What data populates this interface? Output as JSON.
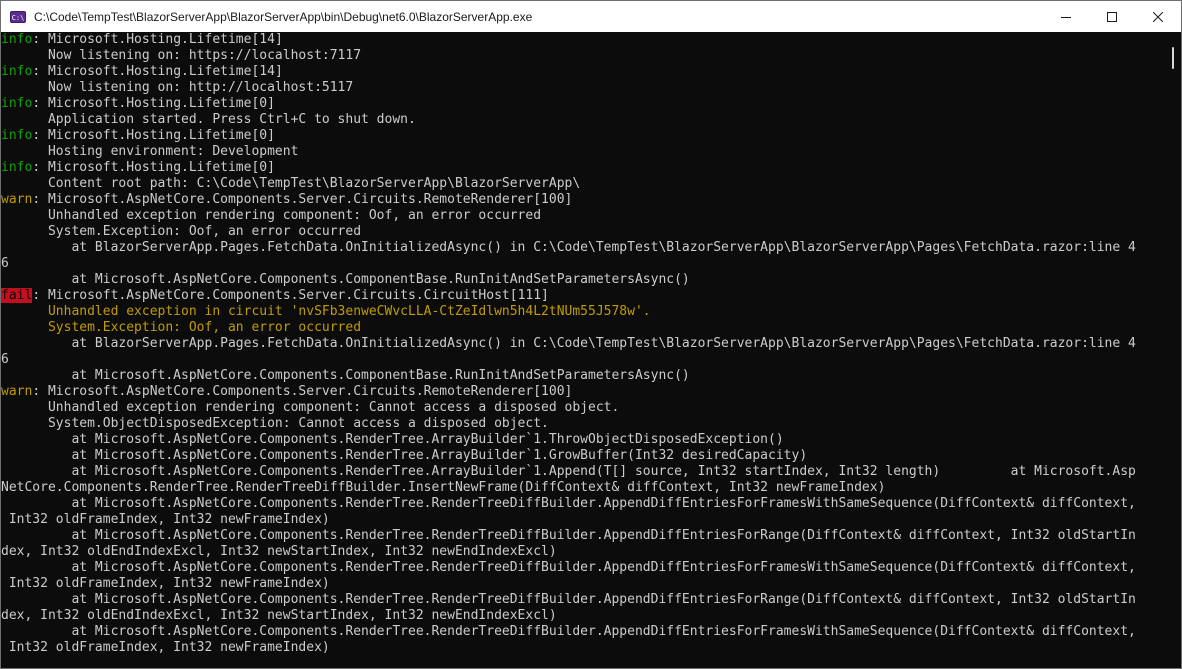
{
  "window": {
    "title": "C:\\Code\\TempTest\\BlazorServerApp\\BlazorServerApp\\bin\\Debug\\net6.0\\BlazorServerApp.exe",
    "icon_text": "C:\\",
    "icon": "console-app-icon"
  },
  "controls": {
    "minimize": "minimize-icon",
    "maximize": "maximize-icon",
    "close": "close-icon"
  },
  "colors": {
    "info": "#13a10e",
    "warn": "#c19c00",
    "fail_bg": "#c50f1f",
    "text": "#cccccc",
    "background": "#0c0c0c"
  },
  "console": {
    "lines": [
      {
        "tag": "info",
        "text": ": Microsoft.Hosting.Lifetime[14]"
      },
      {
        "tag": "",
        "text": "      Now listening on: https://localhost:7117"
      },
      {
        "tag": "info",
        "text": ": Microsoft.Hosting.Lifetime[14]"
      },
      {
        "tag": "",
        "text": "      Now listening on: http://localhost:5117"
      },
      {
        "tag": "info",
        "text": ": Microsoft.Hosting.Lifetime[0]"
      },
      {
        "tag": "",
        "text": "      Application started. Press Ctrl+C to shut down."
      },
      {
        "tag": "info",
        "text": ": Microsoft.Hosting.Lifetime[0]"
      },
      {
        "tag": "",
        "text": "      Hosting environment: Development"
      },
      {
        "tag": "info",
        "text": ": Microsoft.Hosting.Lifetime[0]"
      },
      {
        "tag": "",
        "text": "      Content root path: C:\\Code\\TempTest\\BlazorServerApp\\BlazorServerApp\\"
      },
      {
        "tag": "warn",
        "text": ": Microsoft.AspNetCore.Components.Server.Circuits.RemoteRenderer[100]"
      },
      {
        "tag": "",
        "text": "      Unhandled exception rendering component: Oof, an error occurred"
      },
      {
        "tag": "",
        "text": "      System.Exception: Oof, an error occurred"
      },
      {
        "tag": "",
        "text": "         at BlazorServerApp.Pages.FetchData.OnInitializedAsync() in C:\\Code\\TempTest\\BlazorServerApp\\BlazorServerApp\\Pages\\FetchData.razor:line 4"
      },
      {
        "tag": "",
        "text": "6"
      },
      {
        "tag": "",
        "text": "         at Microsoft.AspNetCore.Components.ComponentBase.RunInitAndSetParametersAsync()"
      },
      {
        "tag": "fail",
        "text": ": Microsoft.AspNetCore.Components.Server.Circuits.CircuitHost[111]"
      },
      {
        "tag": "yellow",
        "text": "      Unhandled exception in circuit 'nvSFb3enweCWvcLLA-CtZeIdlwn5h4L2tNUm55J578w'."
      },
      {
        "tag": "yellow",
        "text": "      System.Exception: Oof, an error occurred"
      },
      {
        "tag": "",
        "text": "         at BlazorServerApp.Pages.FetchData.OnInitializedAsync() in C:\\Code\\TempTest\\BlazorServerApp\\BlazorServerApp\\Pages\\FetchData.razor:line 4"
      },
      {
        "tag": "",
        "text": "6"
      },
      {
        "tag": "",
        "text": "         at Microsoft.AspNetCore.Components.ComponentBase.RunInitAndSetParametersAsync()"
      },
      {
        "tag": "warn",
        "text": ": Microsoft.AspNetCore.Components.Server.Circuits.RemoteRenderer[100]"
      },
      {
        "tag": "",
        "text": "      Unhandled exception rendering component: Cannot access a disposed object."
      },
      {
        "tag": "",
        "text": "      System.ObjectDisposedException: Cannot access a disposed object."
      },
      {
        "tag": "",
        "text": "         at Microsoft.AspNetCore.Components.RenderTree.ArrayBuilder`1.ThrowObjectDisposedException()"
      },
      {
        "tag": "",
        "text": "         at Microsoft.AspNetCore.Components.RenderTree.ArrayBuilder`1.GrowBuffer(Int32 desiredCapacity)"
      },
      {
        "tag": "",
        "text": "         at Microsoft.AspNetCore.Components.RenderTree.ArrayBuilder`1.Append(T[] source, Int32 startIndex, Int32 length)         at Microsoft.Asp"
      },
      {
        "tag": "",
        "text": "NetCore.Components.RenderTree.RenderTreeDiffBuilder.InsertNewFrame(DiffContext& diffContext, Int32 newFrameIndex)"
      },
      {
        "tag": "",
        "text": "         at Microsoft.AspNetCore.Components.RenderTree.RenderTreeDiffBuilder.AppendDiffEntriesForFramesWithSameSequence(DiffContext& diffContext,"
      },
      {
        "tag": "",
        "text": " Int32 oldFrameIndex, Int32 newFrameIndex)"
      },
      {
        "tag": "",
        "text": "         at Microsoft.AspNetCore.Components.RenderTree.RenderTreeDiffBuilder.AppendDiffEntriesForRange(DiffContext& diffContext, Int32 oldStartIn"
      },
      {
        "tag": "",
        "text": "dex, Int32 oldEndIndexExcl, Int32 newStartIndex, Int32 newEndIndexExcl)"
      },
      {
        "tag": "",
        "text": "         at Microsoft.AspNetCore.Components.RenderTree.RenderTreeDiffBuilder.AppendDiffEntriesForFramesWithSameSequence(DiffContext& diffContext,"
      },
      {
        "tag": "",
        "text": " Int32 oldFrameIndex, Int32 newFrameIndex)"
      },
      {
        "tag": "",
        "text": "         at Microsoft.AspNetCore.Components.RenderTree.RenderTreeDiffBuilder.AppendDiffEntriesForRange(DiffContext& diffContext, Int32 oldStartIn"
      },
      {
        "tag": "",
        "text": "dex, Int32 oldEndIndexExcl, Int32 newStartIndex, Int32 newEndIndexExcl)"
      },
      {
        "tag": "",
        "text": "         at Microsoft.AspNetCore.Components.RenderTree.RenderTreeDiffBuilder.AppendDiffEntriesForFramesWithSameSequence(DiffContext& diffContext,"
      },
      {
        "tag": "",
        "text": " Int32 oldFrameIndex, Int32 newFrameIndex)"
      }
    ]
  }
}
